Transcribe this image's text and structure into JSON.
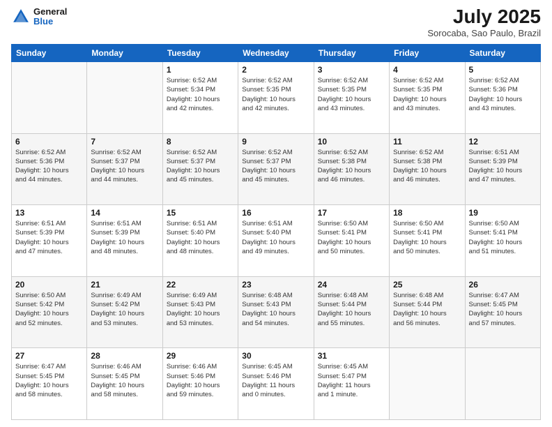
{
  "header": {
    "logo_general": "General",
    "logo_blue": "Blue",
    "month_year": "July 2025",
    "location": "Sorocaba, Sao Paulo, Brazil"
  },
  "weekdays": [
    "Sunday",
    "Monday",
    "Tuesday",
    "Wednesday",
    "Thursday",
    "Friday",
    "Saturday"
  ],
  "weeks": [
    [
      {
        "day": "",
        "info": ""
      },
      {
        "day": "",
        "info": ""
      },
      {
        "day": "1",
        "info": "Sunrise: 6:52 AM\nSunset: 5:34 PM\nDaylight: 10 hours\nand 42 minutes."
      },
      {
        "day": "2",
        "info": "Sunrise: 6:52 AM\nSunset: 5:35 PM\nDaylight: 10 hours\nand 42 minutes."
      },
      {
        "day": "3",
        "info": "Sunrise: 6:52 AM\nSunset: 5:35 PM\nDaylight: 10 hours\nand 43 minutes."
      },
      {
        "day": "4",
        "info": "Sunrise: 6:52 AM\nSunset: 5:35 PM\nDaylight: 10 hours\nand 43 minutes."
      },
      {
        "day": "5",
        "info": "Sunrise: 6:52 AM\nSunset: 5:36 PM\nDaylight: 10 hours\nand 43 minutes."
      }
    ],
    [
      {
        "day": "6",
        "info": "Sunrise: 6:52 AM\nSunset: 5:36 PM\nDaylight: 10 hours\nand 44 minutes."
      },
      {
        "day": "7",
        "info": "Sunrise: 6:52 AM\nSunset: 5:37 PM\nDaylight: 10 hours\nand 44 minutes."
      },
      {
        "day": "8",
        "info": "Sunrise: 6:52 AM\nSunset: 5:37 PM\nDaylight: 10 hours\nand 45 minutes."
      },
      {
        "day": "9",
        "info": "Sunrise: 6:52 AM\nSunset: 5:37 PM\nDaylight: 10 hours\nand 45 minutes."
      },
      {
        "day": "10",
        "info": "Sunrise: 6:52 AM\nSunset: 5:38 PM\nDaylight: 10 hours\nand 46 minutes."
      },
      {
        "day": "11",
        "info": "Sunrise: 6:52 AM\nSunset: 5:38 PM\nDaylight: 10 hours\nand 46 minutes."
      },
      {
        "day": "12",
        "info": "Sunrise: 6:51 AM\nSunset: 5:39 PM\nDaylight: 10 hours\nand 47 minutes."
      }
    ],
    [
      {
        "day": "13",
        "info": "Sunrise: 6:51 AM\nSunset: 5:39 PM\nDaylight: 10 hours\nand 47 minutes."
      },
      {
        "day": "14",
        "info": "Sunrise: 6:51 AM\nSunset: 5:39 PM\nDaylight: 10 hours\nand 48 minutes."
      },
      {
        "day": "15",
        "info": "Sunrise: 6:51 AM\nSunset: 5:40 PM\nDaylight: 10 hours\nand 48 minutes."
      },
      {
        "day": "16",
        "info": "Sunrise: 6:51 AM\nSunset: 5:40 PM\nDaylight: 10 hours\nand 49 minutes."
      },
      {
        "day": "17",
        "info": "Sunrise: 6:50 AM\nSunset: 5:41 PM\nDaylight: 10 hours\nand 50 minutes."
      },
      {
        "day": "18",
        "info": "Sunrise: 6:50 AM\nSunset: 5:41 PM\nDaylight: 10 hours\nand 50 minutes."
      },
      {
        "day": "19",
        "info": "Sunrise: 6:50 AM\nSunset: 5:41 PM\nDaylight: 10 hours\nand 51 minutes."
      }
    ],
    [
      {
        "day": "20",
        "info": "Sunrise: 6:50 AM\nSunset: 5:42 PM\nDaylight: 10 hours\nand 52 minutes."
      },
      {
        "day": "21",
        "info": "Sunrise: 6:49 AM\nSunset: 5:42 PM\nDaylight: 10 hours\nand 53 minutes."
      },
      {
        "day": "22",
        "info": "Sunrise: 6:49 AM\nSunset: 5:43 PM\nDaylight: 10 hours\nand 53 minutes."
      },
      {
        "day": "23",
        "info": "Sunrise: 6:48 AM\nSunset: 5:43 PM\nDaylight: 10 hours\nand 54 minutes."
      },
      {
        "day": "24",
        "info": "Sunrise: 6:48 AM\nSunset: 5:44 PM\nDaylight: 10 hours\nand 55 minutes."
      },
      {
        "day": "25",
        "info": "Sunrise: 6:48 AM\nSunset: 5:44 PM\nDaylight: 10 hours\nand 56 minutes."
      },
      {
        "day": "26",
        "info": "Sunrise: 6:47 AM\nSunset: 5:45 PM\nDaylight: 10 hours\nand 57 minutes."
      }
    ],
    [
      {
        "day": "27",
        "info": "Sunrise: 6:47 AM\nSunset: 5:45 PM\nDaylight: 10 hours\nand 58 minutes."
      },
      {
        "day": "28",
        "info": "Sunrise: 6:46 AM\nSunset: 5:45 PM\nDaylight: 10 hours\nand 58 minutes."
      },
      {
        "day": "29",
        "info": "Sunrise: 6:46 AM\nSunset: 5:46 PM\nDaylight: 10 hours\nand 59 minutes."
      },
      {
        "day": "30",
        "info": "Sunrise: 6:45 AM\nSunset: 5:46 PM\nDaylight: 11 hours\nand 0 minutes."
      },
      {
        "day": "31",
        "info": "Sunrise: 6:45 AM\nSunset: 5:47 PM\nDaylight: 11 hours\nand 1 minute."
      },
      {
        "day": "",
        "info": ""
      },
      {
        "day": "",
        "info": ""
      }
    ]
  ]
}
